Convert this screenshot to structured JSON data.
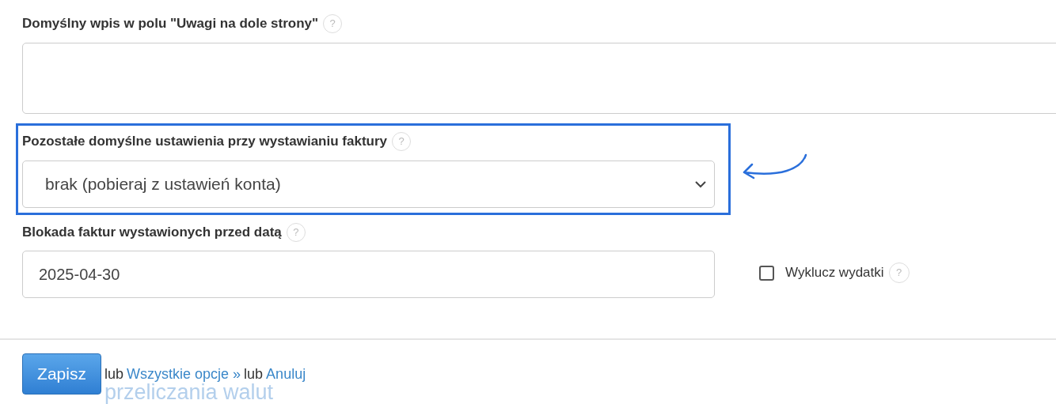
{
  "notes_field": {
    "label": "Domyślny wpis w polu \"Uwagi na dole strony\"",
    "help": "?"
  },
  "other_defaults": {
    "label": "Pozostałe domyślne ustawienia przy wystawianiu faktury",
    "help": "?",
    "value": "brak (pobieraj z ustawień konta)",
    "highlighted": true
  },
  "lock_date": {
    "label": "Blokada faktur wystawionych przed datą",
    "help": "?",
    "value": "2025-04-30"
  },
  "exclude_expenses": {
    "label": "Wyklucz wydatki",
    "help": "?",
    "checked": false
  },
  "actions": {
    "save": "Zapisz",
    "or_1": "lub",
    "all_options": "Wszystkie opcje »",
    "or_2": "lub",
    "cancel": "Anuluj"
  },
  "faded_heading": "przeliczania walut"
}
